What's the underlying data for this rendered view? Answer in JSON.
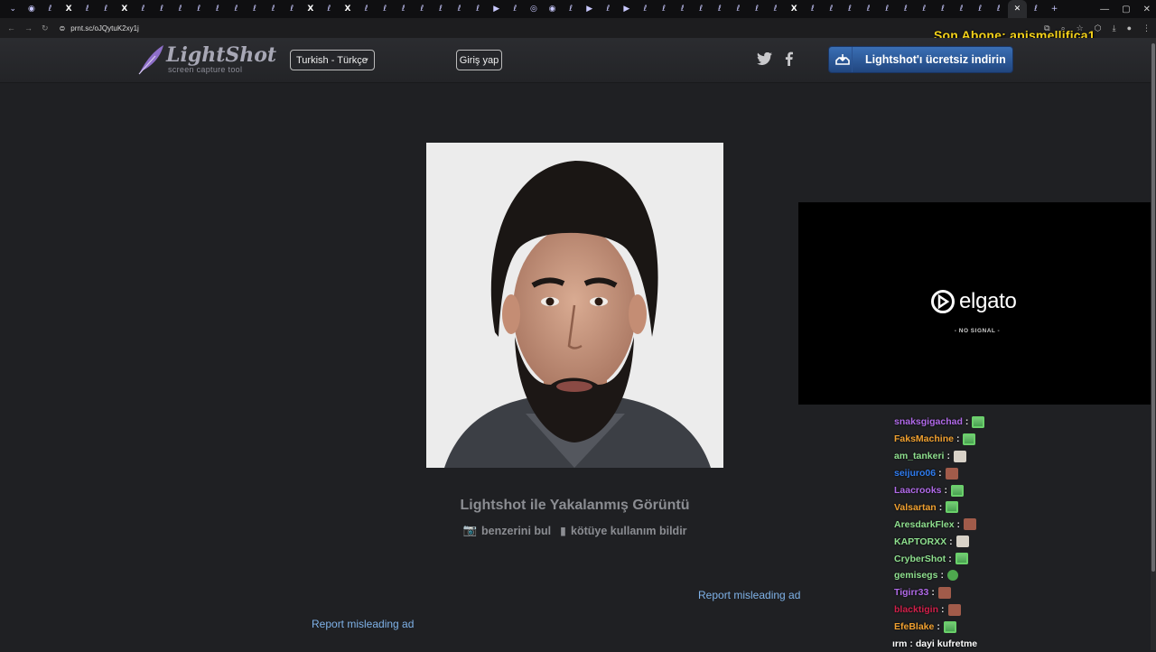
{
  "browser": {
    "tabs": [
      "⌄",
      "◉",
      "ℓ",
      "X",
      "ℓ",
      "ℓ",
      "X",
      "ℓ",
      "ℓ",
      "ℓ",
      "ℓ",
      "ℓ",
      "ℓ",
      "ℓ",
      "ℓ",
      "ℓ",
      "X",
      "ℓ",
      "X",
      "ℓ",
      "ℓ",
      "ℓ",
      "ℓ",
      "ℓ",
      "ℓ",
      "ℓ",
      "▶",
      "ℓ",
      "◎",
      "◉",
      "ℓ",
      "▶",
      "ℓ",
      "▶",
      "ℓ",
      "ℓ",
      "ℓ",
      "ℓ",
      "ℓ",
      "ℓ",
      "ℓ",
      "ℓ",
      "X",
      "ℓ",
      "ℓ",
      "ℓ",
      "ℓ",
      "ℓ",
      "ℓ",
      "ℓ",
      "ℓ",
      "ℓ",
      "ℓ",
      "ℓ",
      "✕",
      "ℓ",
      "+"
    ],
    "url": "prnt.sc/oJQytuK2xy1j",
    "window_controls": [
      "—",
      "▢",
      "✕"
    ],
    "nav": [
      "←",
      "→",
      "↻"
    ]
  },
  "stream_overlay": {
    "last_subscriber": "Son Abone: apismellifica1"
  },
  "site": {
    "logo_title": "LightShot",
    "logo_sub": "screen capture tool",
    "language": "Turkish - Türkçe",
    "login": "Giriş yap",
    "download": "Lightshot'ı ücretsiz indirin",
    "caption": "Lightshot ile Yakalanmış Görüntü",
    "find_similar": "benzerini bul",
    "report_abuse": "kötüye kullanım bildir",
    "report_ad_1": "Report misleading ad",
    "report_ad_2": "Report misleading ad"
  },
  "elgato": {
    "brand": "elgato",
    "status": "- NO SIGNAL -"
  },
  "chat": [
    {
      "user": "snaksgigachad",
      "color": "#b06ae8",
      "emote": "e-green"
    },
    {
      "user": "FaksMachine",
      "color": "#f0a030",
      "emote": "e-green"
    },
    {
      "user": "am_tankeri",
      "color": "#8fe08f",
      "emote": "e-white"
    },
    {
      "user": "seijuro06",
      "color": "#2f7cf0",
      "emote": "e-brown"
    },
    {
      "user": "Laacrooks",
      "color": "#b06ae8",
      "emote": "e-green"
    },
    {
      "user": "Valsartan",
      "color": "#f0a030",
      "emote": "e-green"
    },
    {
      "user": "AresdarkFlex",
      "color": "#8fe08f",
      "emote": "e-brown"
    },
    {
      "user": "KAPTORXX",
      "color": "#8fe08f",
      "emote": "e-white"
    },
    {
      "user": "CryberShot",
      "color": "#8fe08f",
      "emote": "e-green"
    },
    {
      "user": "gemisegs",
      "color": "#8fe08f",
      "emote": "e-round"
    },
    {
      "user": "Tigirr33",
      "color": "#b06ae8",
      "emote": "e-brown"
    },
    {
      "user": "blacktigin",
      "color": "#d0204a",
      "emote": "e-brown"
    },
    {
      "user": "EfeBlake",
      "color": "#f0a030",
      "emote": "e-green"
    }
  ],
  "chat_last": {
    "user": "ırm",
    "message": "dayi kufretme"
  }
}
